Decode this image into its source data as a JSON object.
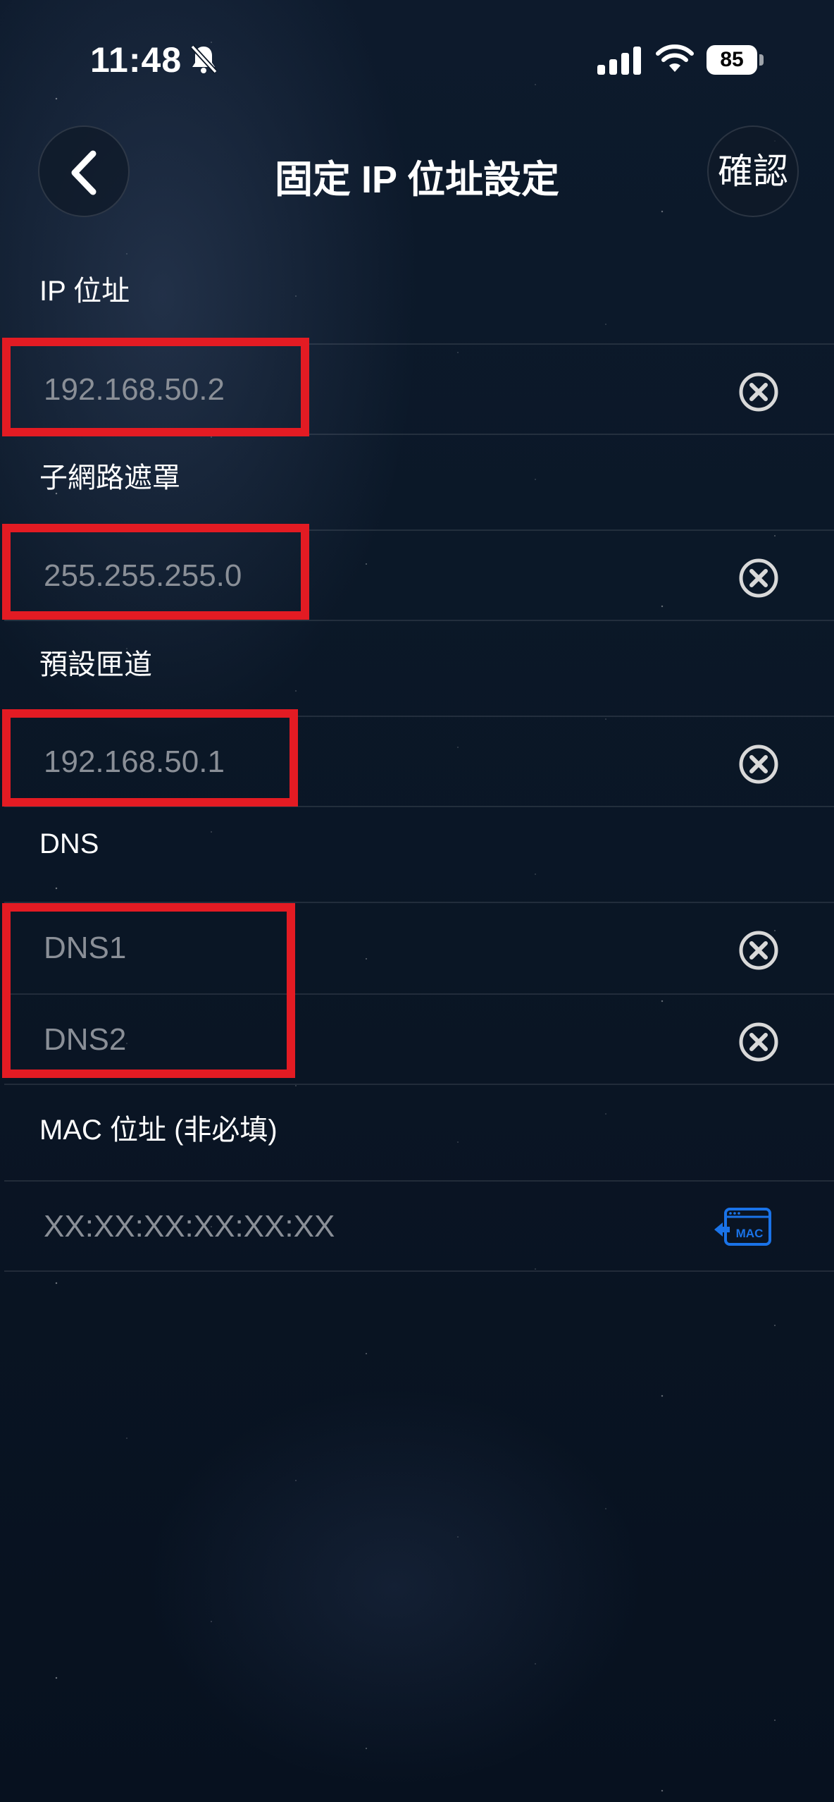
{
  "status_bar": {
    "time": "11:48",
    "battery": "85",
    "icons": [
      "bell-slash-icon",
      "cellular-signal-icon",
      "wifi-icon",
      "battery-icon"
    ]
  },
  "nav": {
    "title": "固定 IP 位址設定",
    "confirm_label": "確認",
    "back_icon": "chevron-left-icon"
  },
  "form": {
    "ip": {
      "label": "IP 位址",
      "placeholder": "192.168.50.2"
    },
    "subnet": {
      "label": "子網路遮罩",
      "placeholder": "255.255.255.0"
    },
    "gateway": {
      "label": "預設匣道",
      "placeholder": "192.168.50.1"
    },
    "dns": {
      "label": "DNS",
      "dns1_placeholder": "DNS1",
      "dns2_placeholder": "DNS2"
    },
    "mac": {
      "label": "MAC 位址 (非必填)",
      "placeholder": "XX:XX:XX:XX:XX:XX",
      "icon_text": "MAC"
    }
  },
  "colors": {
    "highlight": "#e31b23",
    "placeholder": "#8a8f97",
    "mac_icon": "#1a73e8"
  }
}
